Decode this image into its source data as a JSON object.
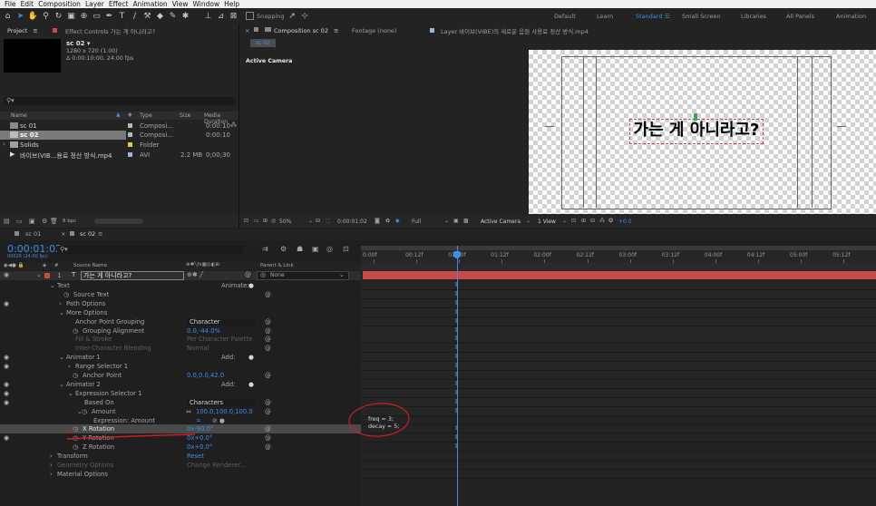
{
  "menu": [
    "File",
    "Edit",
    "Composition",
    "Layer",
    "Effect",
    "Animation",
    "View",
    "Window",
    "Help"
  ],
  "toolbar": {
    "snapping_label": "Snapping"
  },
  "workspaces": [
    "Default",
    "Learn",
    "Standard",
    "Small Screen",
    "Libraries",
    "All Panels",
    "Animation"
  ],
  "project_panel": {
    "tab_label": "Project",
    "effect_controls_tab": "Effect Controls 가는 게 아니라고?",
    "comp_name": "sc 02 ▾",
    "comp_info_1": "1280 x 720 (1.00)",
    "comp_info_2": "Δ 0:00:10:00, 24.00 fps",
    "columns": [
      "Name",
      "Type",
      "Size",
      "Media Duration"
    ],
    "items": [
      {
        "name": "sc 01",
        "type": "Composi...",
        "size": "",
        "duration": "0:00:10"
      },
      {
        "name": "sc 02",
        "type": "Composi...",
        "size": "",
        "duration": "0:00:10"
      },
      {
        "name": "Solids",
        "type": "Folder",
        "size": "",
        "duration": ""
      },
      {
        "name": "바이브(VIB...용료 정산 방식.mp4",
        "type": "AVI",
        "size": "2.2 MB",
        "duration": "0;00;30"
      }
    ],
    "bpc_label": "8 bpc"
  },
  "composition_panel": {
    "tab_label": "Composition sc 02",
    "footage_tab": "Footage (none)",
    "layer_tab": "Layer 바이브(VIBE)의 새로운 음원 사용료 정산 방식.mp4",
    "sub_tab": "sc 02",
    "active_camera": "Active Camera",
    "canvas_text": "가는 게 아니라고?",
    "zoom": "50%",
    "timecode": "0:00:01:02",
    "resolution": "Full",
    "camera_dropdown": "Active Camera",
    "view_dropdown": "1 View",
    "exposure": "+0.0"
  },
  "timeline": {
    "tabs": [
      "sc 01",
      "sc 02"
    ],
    "current_time": "0:00:01:02",
    "frame_info": "00026 (24.00 fps)",
    "search_placeholder": "",
    "source_name_header": "Source Name",
    "parent_header": "Parent & Link",
    "layer_number": "1",
    "layer_name": "가는 게 아니라고?",
    "parent_value": "None",
    "ruler_ticks": [
      "0:00f",
      "00:12f",
      "01:00f",
      "01:12f",
      "02:00f",
      "02:12f",
      "03:00f",
      "03:12f",
      "04:00f",
      "04:12f",
      "05:00f",
      "05:12f"
    ],
    "properties": [
      {
        "label": "Text",
        "value": "",
        "right": "Animate:",
        "indent": 1
      },
      {
        "label": "Source Text",
        "value": "",
        "right": "",
        "indent": 2
      },
      {
        "label": "Path Options",
        "value": "",
        "right": "",
        "indent": 2
      },
      {
        "label": "More Options",
        "value": "",
        "right": "",
        "indent": 2
      },
      {
        "label": "Anchor Point Grouping",
        "value": "Character",
        "right": "",
        "indent": 3
      },
      {
        "label": "Grouping Alignment",
        "value": "0.0,-44.0%",
        "right": "",
        "indent": 3
      },
      {
        "label": "Fill & Stroke",
        "value": "Per Character Palette",
        "right": "",
        "indent": 3,
        "dim": true
      },
      {
        "label": "Inter-Character Blending",
        "value": "Normal",
        "right": "",
        "indent": 3,
        "dim": true
      },
      {
        "label": "Animator 1",
        "value": "",
        "right": "Add:",
        "indent": 2
      },
      {
        "label": "Range Selector 1",
        "value": "",
        "right": "",
        "indent": 3
      },
      {
        "label": "Anchor Point",
        "value": "0.0,0.0,42.0",
        "right": "",
        "indent": 3
      },
      {
        "label": "Animator 2",
        "value": "",
        "right": "Add:",
        "indent": 2
      },
      {
        "label": "Expression Selector 1",
        "value": "",
        "right": "",
        "indent": 3
      },
      {
        "label": "Based On",
        "value": "Characters",
        "right": "",
        "indent": 4
      },
      {
        "label": "Amount",
        "value": "100.0,100.0,100.0",
        "right": "",
        "indent": 4
      },
      {
        "label": "Expression: Amount",
        "value": "",
        "right": "",
        "indent": 5
      },
      {
        "label": "X Rotation",
        "value": "0x-90.0°",
        "right": "",
        "indent": 3
      },
      {
        "label": "Y Rotation",
        "value": "0x+0.0°",
        "right": "",
        "indent": 3
      },
      {
        "label": "Z Rotation",
        "value": "0x+0.0°",
        "right": "",
        "indent": 3
      },
      {
        "label": "Transform",
        "value": "Reset",
        "right": "",
        "indent": 1
      },
      {
        "label": "Geometry Options",
        "value": "Change Renderer...",
        "right": "",
        "indent": 1,
        "dim": true
      },
      {
        "label": "Material Options",
        "value": "",
        "right": "",
        "indent": 1
      }
    ],
    "expression_lines": [
      "freq = 3;",
      "decay = 5;"
    ]
  },
  "colors": {
    "accent": "#3d8fe6",
    "annotation": "#cc1f1f",
    "layer_bar": "#c94a4a"
  }
}
